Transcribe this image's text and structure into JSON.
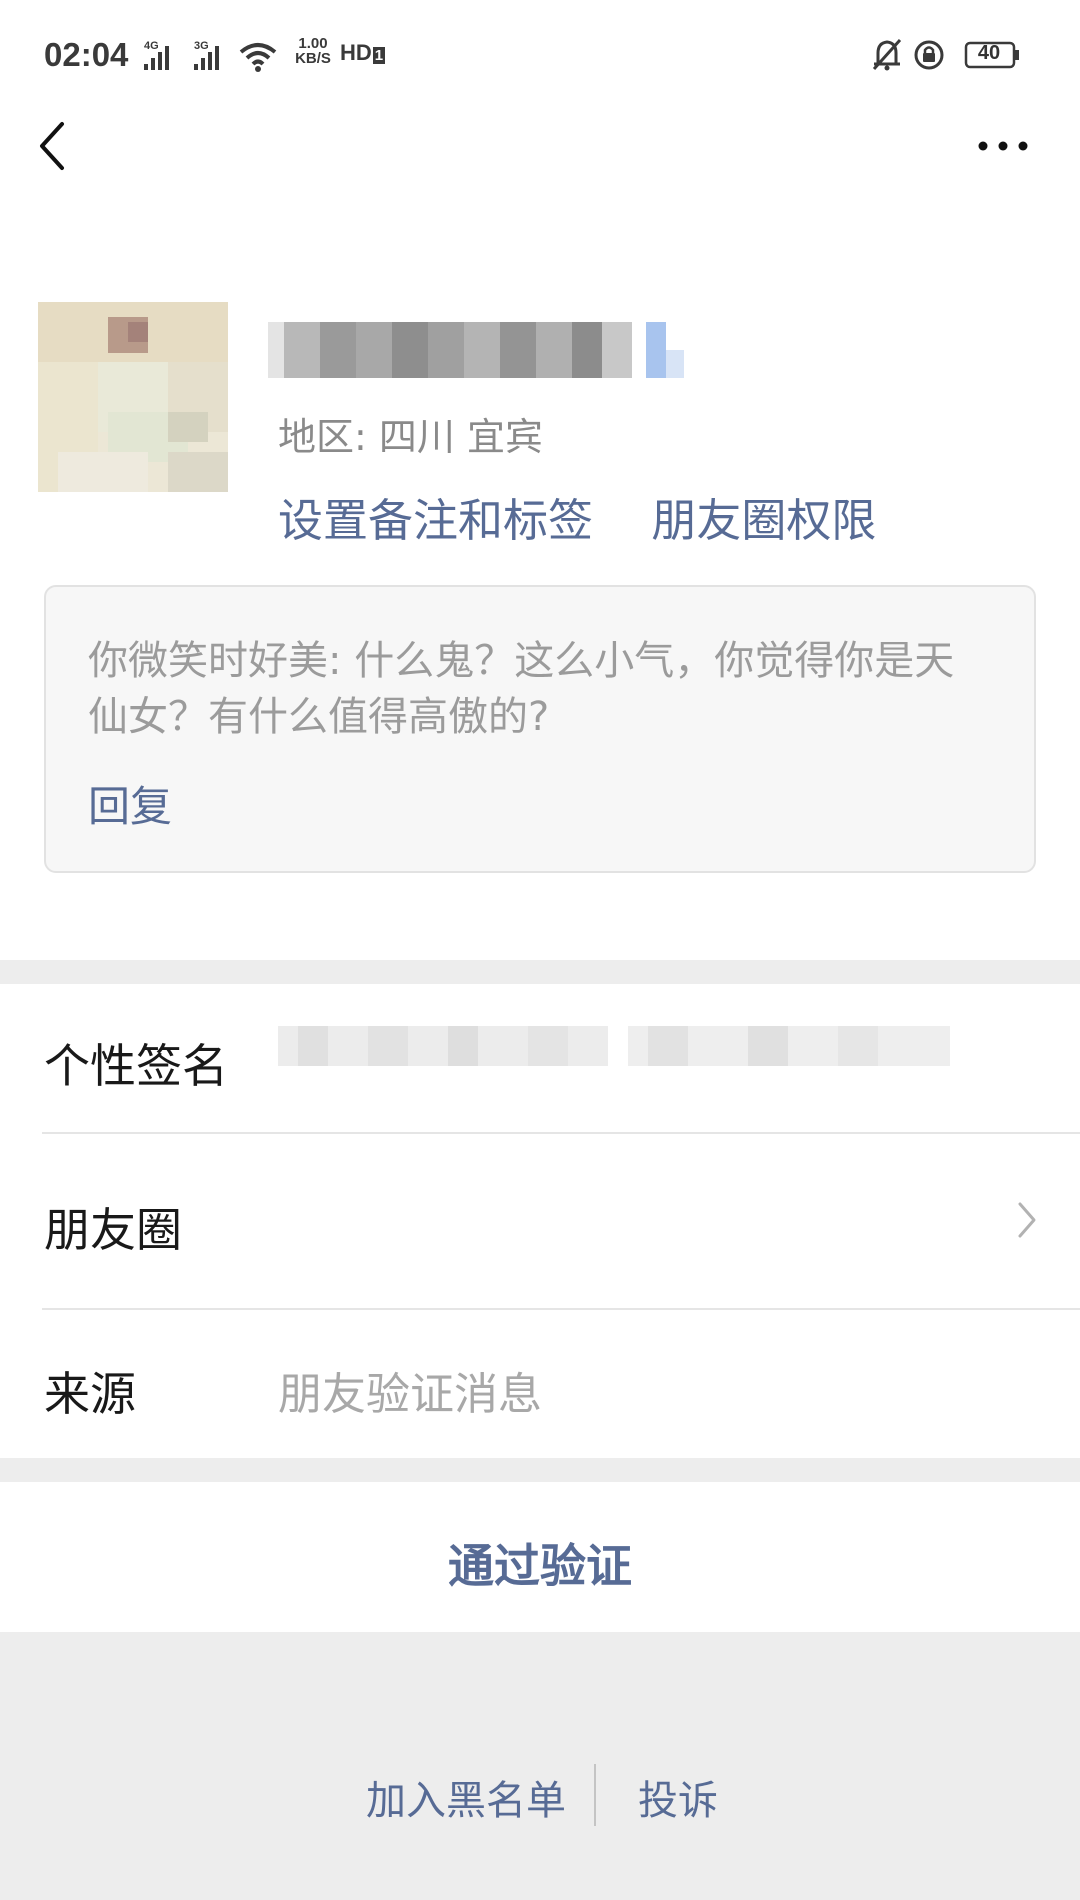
{
  "status_bar": {
    "time": "02:04",
    "network_1": "4G",
    "network_2": "3G",
    "speed_value": "1.00",
    "speed_unit": "KB/S",
    "hd_label": "HD",
    "hd_sim": "1",
    "battery": "40",
    "icons": [
      "signal-icon",
      "wifi-icon",
      "mute-bell-icon",
      "rotation-lock-icon",
      "battery-icon"
    ]
  },
  "nav": {
    "back_icon": "back-arrow-icon",
    "more_icon": "more-dots-icon"
  },
  "profile": {
    "region": "地区:  四川  宜宾",
    "set_remark": "设置备注和标签",
    "moments_permission": "朋友圈权限"
  },
  "message": {
    "text": "你微笑时好美: 什么鬼？这么小气，你觉得你是天仙女？有什么值得高傲的?",
    "reply": "回复"
  },
  "info": {
    "signature_label": "个性签名",
    "moments_label": "朋友圈",
    "source_label": "来源",
    "source_value": "朋友验证消息"
  },
  "actions": {
    "approve": "通过验证",
    "blacklist": "加入黑名单",
    "report": "投诉"
  },
  "colors": {
    "link": "#576b95",
    "background": "#ededed",
    "card": "#ffffff",
    "muted_text": "#9b9b9b"
  }
}
